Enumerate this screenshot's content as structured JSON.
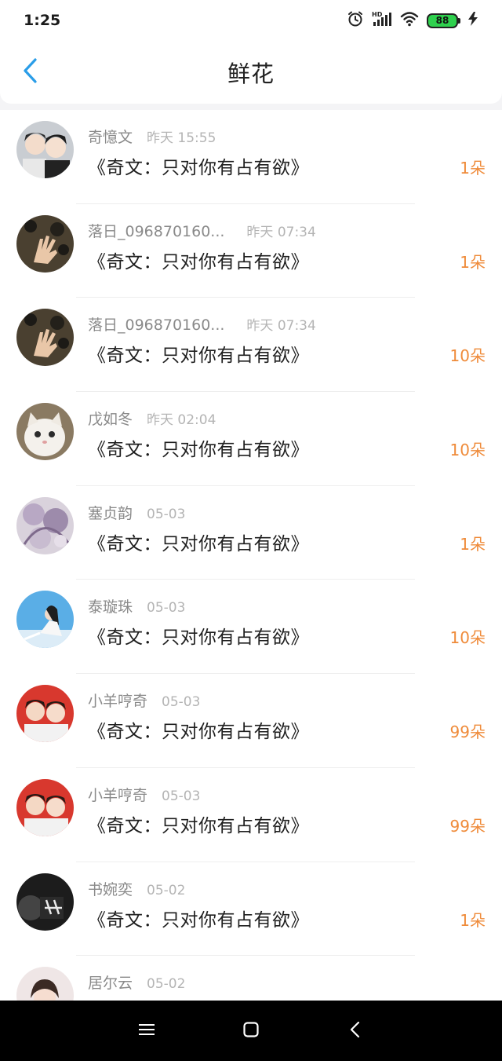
{
  "status_bar": {
    "time": "1:25",
    "battery": "88",
    "icons": [
      "alarm-icon",
      "hd-signal-icon",
      "wifi-icon",
      "battery-icon",
      "charging-icon"
    ]
  },
  "header": {
    "title": "鲜花",
    "back_icon": "chevron-left-icon",
    "accent_color": "#2a9de8"
  },
  "gifts": [
    {
      "name": "奇憶文",
      "time": "昨天 15:55",
      "book": "《奇文：只对你有占有欲》",
      "count": "1朵"
    },
    {
      "name": "落日_096870160...",
      "time": "昨天 07:34",
      "book": "《奇文：只对你有占有欲》",
      "count": "1朵"
    },
    {
      "name": "落日_096870160...",
      "time": "昨天 07:34",
      "book": "《奇文：只对你有占有欲》",
      "count": "10朵"
    },
    {
      "name": "戊如冬",
      "time": "昨天 02:04",
      "book": "《奇文：只对你有占有欲》",
      "count": "10朵"
    },
    {
      "name": "塞贞韵",
      "time": "05-03",
      "book": "《奇文：只对你有占有欲》",
      "count": "1朵"
    },
    {
      "name": "泰璇珠",
      "time": "05-03",
      "book": "《奇文：只对你有占有欲》",
      "count": "10朵"
    },
    {
      "name": "小羊哼奇",
      "time": "05-03",
      "book": "《奇文：只对你有占有欲》",
      "count": "99朵"
    },
    {
      "name": "小羊哼奇",
      "time": "05-03",
      "book": "《奇文：只对你有占有欲》",
      "count": "99朵"
    },
    {
      "name": "书婉奕",
      "time": "05-02",
      "book": "《奇文：只对你有占有欲》",
      "count": "1朵"
    },
    {
      "name": "居尔云",
      "time": "05-02",
      "book": "",
      "count": ""
    }
  ],
  "colors": {
    "count": "#ef8b3a",
    "name": "#8a8a8a",
    "time": "#b4b4b4"
  },
  "nav_bar": {
    "icons": [
      "menu-icon",
      "home-square-icon",
      "back-triangle-icon"
    ]
  }
}
